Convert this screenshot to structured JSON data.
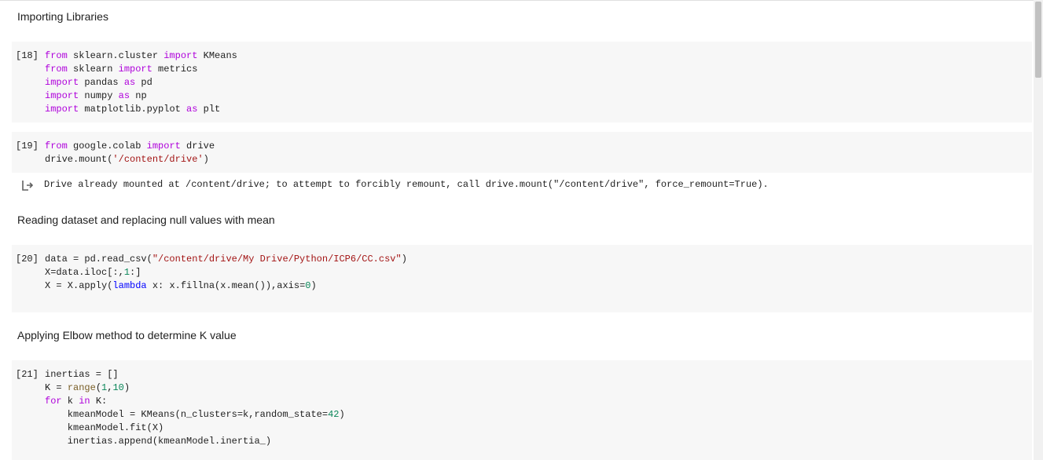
{
  "headings": {
    "importing": "Importing Libraries",
    "reading": "Reading dataset and replacing null values with mean",
    "elbow": "Applying Elbow method to determine K value"
  },
  "cells": {
    "c18": {
      "prompt": "[18]",
      "lines": [
        [
          [
            "kw",
            "from"
          ],
          [
            "t",
            " sklearn.cluster "
          ],
          [
            "kw",
            "import"
          ],
          [
            "t",
            " KMeans"
          ]
        ],
        [
          [
            "kw",
            "from"
          ],
          [
            "t",
            " sklearn "
          ],
          [
            "kw",
            "import"
          ],
          [
            "t",
            " metrics"
          ]
        ],
        [
          [
            "kw",
            "import"
          ],
          [
            "t",
            " pandas "
          ],
          [
            "kw",
            "as"
          ],
          [
            "t",
            " pd"
          ]
        ],
        [
          [
            "kw",
            "import"
          ],
          [
            "t",
            " numpy "
          ],
          [
            "kw",
            "as"
          ],
          [
            "t",
            " np"
          ]
        ],
        [
          [
            "kw",
            "import"
          ],
          [
            "t",
            " matplotlib.pyplot "
          ],
          [
            "kw",
            "as"
          ],
          [
            "t",
            " plt"
          ]
        ]
      ]
    },
    "c19": {
      "prompt": "[19]",
      "lines": [
        [
          [
            "kw",
            "from"
          ],
          [
            "t",
            " google.colab "
          ],
          [
            "kw",
            "import"
          ],
          [
            "t",
            " drive"
          ]
        ],
        [
          [
            "t",
            "drive.mount("
          ],
          [
            "str",
            "'/content/drive'"
          ],
          [
            "t",
            ")"
          ]
        ]
      ]
    },
    "c20": {
      "prompt": "[20]",
      "lines": [
        [
          [
            "t",
            "data = pd.read_csv("
          ],
          [
            "str",
            "\"/content/drive/My Drive/Python/ICP6/CC.csv\""
          ],
          [
            "t",
            ")"
          ]
        ],
        [
          [
            "t",
            "X=data.iloc[:,"
          ],
          [
            "num",
            "1"
          ],
          [
            "t",
            ":]"
          ]
        ],
        [
          [
            "t",
            "X = X.apply("
          ],
          [
            "kw2",
            "lambda"
          ],
          [
            "t",
            " x: x.fillna(x.mean()),axis="
          ],
          [
            "num",
            "0"
          ],
          [
            "t",
            ")"
          ]
        ]
      ]
    },
    "c21": {
      "prompt": "[21]",
      "lines": [
        [
          [
            "t",
            "inertias = []"
          ]
        ],
        [
          [
            "t",
            "K = "
          ],
          [
            "fn",
            "range"
          ],
          [
            "t",
            "("
          ],
          [
            "num",
            "1"
          ],
          [
            "t",
            ","
          ],
          [
            "num",
            "10"
          ],
          [
            "t",
            ")"
          ]
        ],
        [
          [
            "kw",
            "for"
          ],
          [
            "t",
            " k "
          ],
          [
            "kw",
            "in"
          ],
          [
            "t",
            " K:"
          ]
        ],
        [
          [
            "t",
            "    kmeanModel = KMeans(n_clusters=k,random_state="
          ],
          [
            "num",
            "42"
          ],
          [
            "t",
            ")"
          ]
        ],
        [
          [
            "t",
            "    kmeanModel.fit(X)"
          ]
        ],
        [
          [
            "t",
            "    inertias.append(kmeanModel.inertia_)"
          ]
        ]
      ]
    }
  },
  "output": {
    "icon": "output-arrow-icon",
    "text": "Drive already mounted at /content/drive; to attempt to forcibly remount, call drive.mount(\"/content/drive\", force_remount=True)."
  }
}
